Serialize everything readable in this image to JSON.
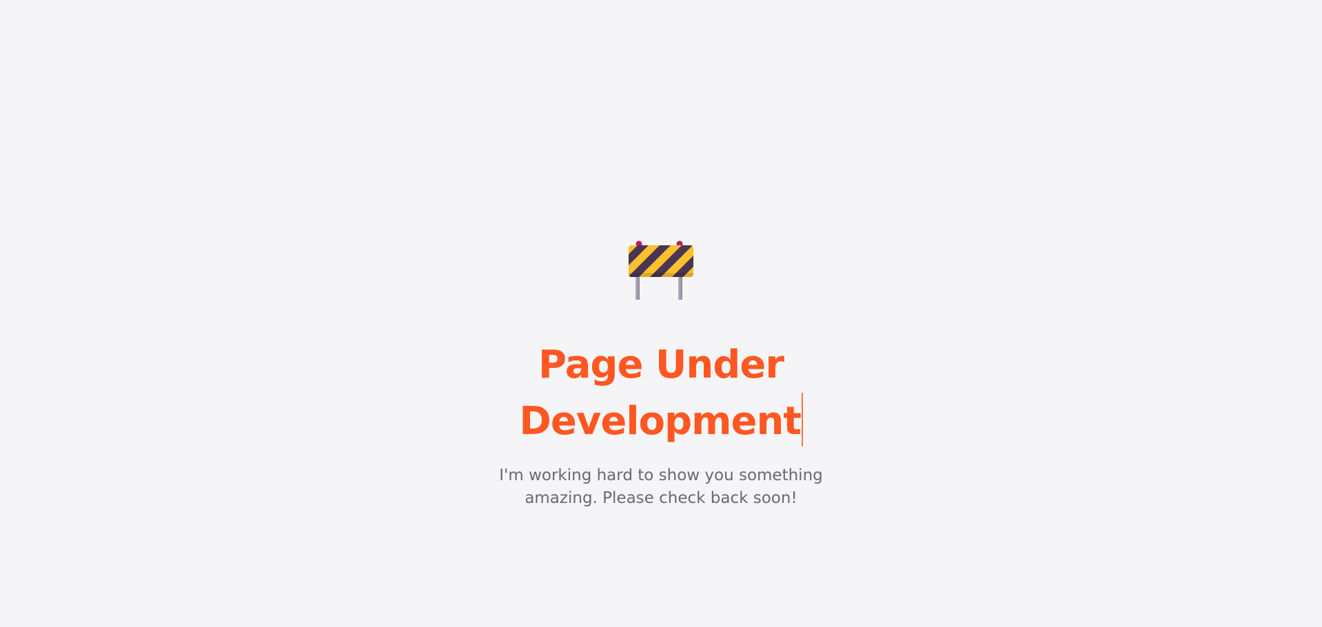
{
  "hero": {
    "icon": "construction-barrier-icon",
    "title_line1": "Page Under",
    "title_line2": "Development",
    "subtitle": "I'm working hard to show you something amazing. Please check back soon!"
  },
  "colors": {
    "background": "#f5f5f7",
    "accent": "#ff5722",
    "text_muted": "#666a70",
    "stripe_yellow": "#fbc02d",
    "stripe_dark": "#4a3552",
    "lamp": "#c2185b",
    "post": "#a9a0b5"
  }
}
